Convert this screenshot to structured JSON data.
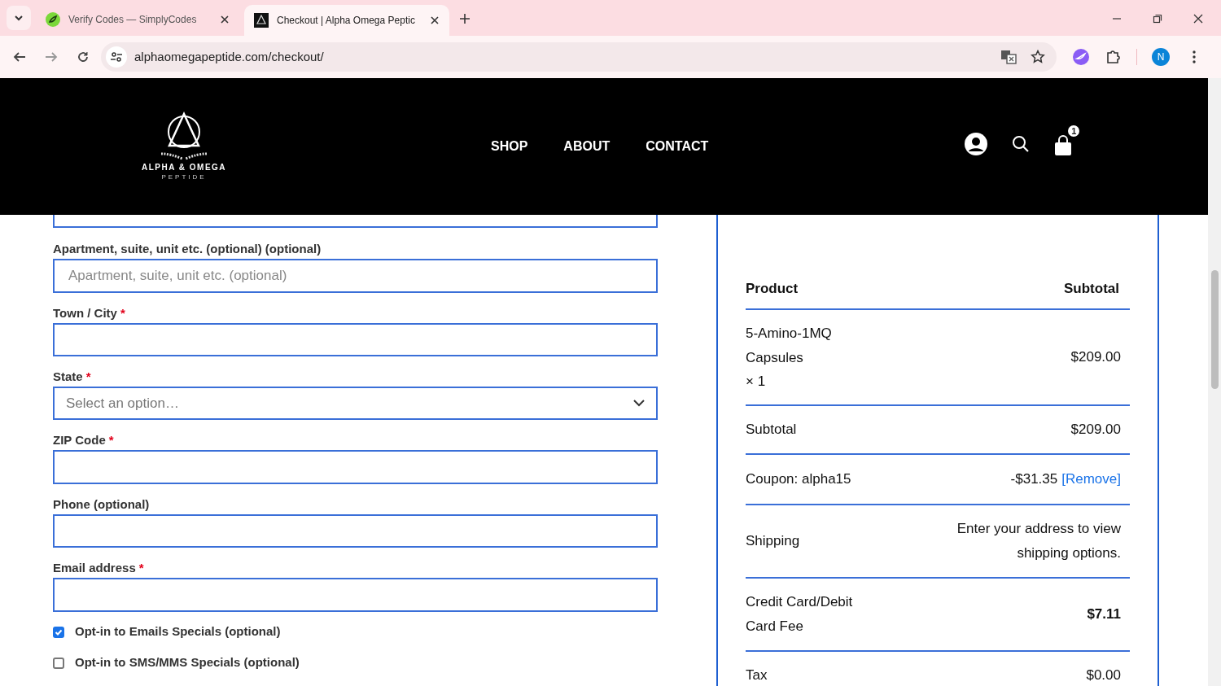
{
  "browser": {
    "tabs": [
      {
        "title": "Verify Codes — SimplyCodes",
        "selected": false
      },
      {
        "title": "Checkout | Alpha Omega Peptic",
        "selected": true
      }
    ],
    "address": "alphaomegapeptide.com/checkout/",
    "profile": "N"
  },
  "header": {
    "logo": {
      "name": "ALPHA & OMEGA",
      "sub": "PEPTIDE"
    },
    "nav": [
      "SHOP",
      "ABOUT",
      "CONTACT"
    ],
    "cart_count": "1"
  },
  "form": {
    "fields": [
      {
        "label": "Apartment, suite, unit etc. (optional) (optional)",
        "kind": "input",
        "placeholder": "Apartment, suite, unit etc. (optional)"
      },
      {
        "label": "Town / City",
        "required_mark": "*",
        "kind": "input"
      },
      {
        "label": "State",
        "required_mark": "*",
        "kind": "select",
        "placeholder": "Select an option…"
      },
      {
        "label": "ZIP Code",
        "required_mark": "*",
        "kind": "input"
      },
      {
        "label": "Phone (optional)",
        "kind": "input"
      },
      {
        "label": "Email address",
        "required_mark": "*",
        "kind": "input"
      }
    ],
    "checkboxes": [
      {
        "label": "Opt-in to Emails Specials (optional)",
        "checked": true
      },
      {
        "label": "Opt-in to SMS/MMS Specials (optional)",
        "checked": false
      }
    ]
  },
  "order": {
    "columns": [
      "Product",
      "Subtotal"
    ],
    "rows": [
      {
        "kind": "product",
        "label": "5-Amino-1MQ Capsules",
        "qty": "× 1",
        "value": "$209.00"
      },
      {
        "kind": "line",
        "label": "Subtotal",
        "value": "$209.00",
        "bold": false
      },
      {
        "kind": "coupon",
        "label": "Coupon: alpha15",
        "value": "-$31.35",
        "link": "[Remove]"
      },
      {
        "kind": "line",
        "label": "Shipping",
        "value": "Enter your address to view shipping options.",
        "bold": false
      },
      {
        "kind": "line",
        "label": "Credit Card/Debit Card Fee",
        "value": "$7.11",
        "bold": true
      },
      {
        "kind": "line",
        "label": "Tax",
        "value": "$0.00",
        "bold": false
      }
    ]
  }
}
